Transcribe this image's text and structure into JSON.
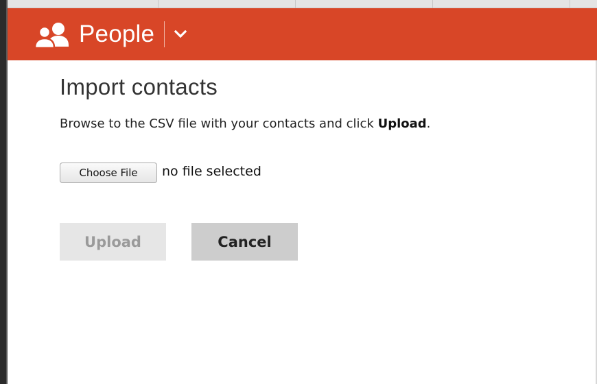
{
  "header": {
    "app_icon": "people-icon",
    "app_title": "People",
    "menu_icon": "chevron-down-icon"
  },
  "main": {
    "page_title": "Import contacts",
    "instruction_prefix": "Browse to the CSV file with your contacts and click ",
    "instruction_emphasis": "Upload",
    "instruction_suffix": ".",
    "file_input": {
      "button_label": "Choose File",
      "status_text": "no file selected"
    },
    "buttons": {
      "upload_label": "Upload",
      "cancel_label": "Cancel"
    }
  },
  "colors": {
    "header_bg": "#d84627",
    "upload_disabled_bg": "#e6e6e6",
    "cancel_bg": "#cdcdcd"
  }
}
